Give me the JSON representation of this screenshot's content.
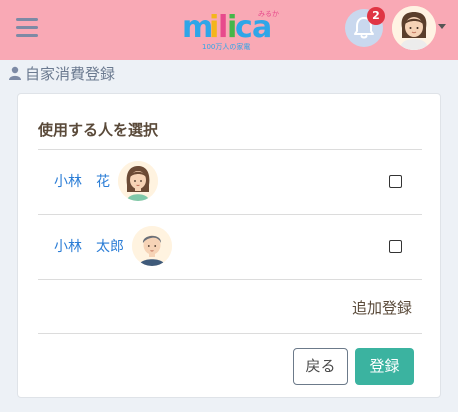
{
  "header": {
    "logo_text": "milica",
    "logo_small_kana": "みるか",
    "logo_tagline": "100万人の家電",
    "notification_count": "2"
  },
  "page": {
    "title": "自家消費登録"
  },
  "card": {
    "heading": "使用する人を選択",
    "persons": [
      {
        "name": "小林　花",
        "checked": false,
        "avatar": "woman-avatar-icon"
      },
      {
        "name": "小林　太郎",
        "checked": false,
        "avatar": "man-avatar-icon"
      }
    ],
    "add_link": "追加登録",
    "back_button": "戻る",
    "register_button": "登録"
  },
  "colors": {
    "header_bg": "#f9a9b5",
    "link_blue": "#2b7dd6",
    "register_green": "#3bb3a0",
    "badge_red": "#e03544"
  }
}
